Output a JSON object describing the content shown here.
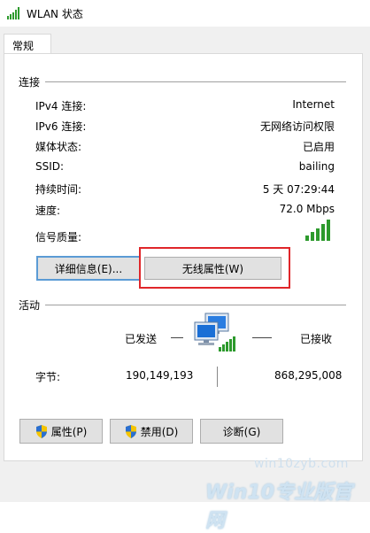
{
  "window": {
    "title": "WLAN 状态"
  },
  "tabs": [
    {
      "label": "常规"
    }
  ],
  "connection": {
    "group_label": "连接",
    "rows": [
      {
        "label": "IPv4 连接:",
        "value": "Internet"
      },
      {
        "label": "IPv6 连接:",
        "value": "无网络访问权限"
      },
      {
        "label": "媒体状态:",
        "value": "已启用"
      },
      {
        "label": "SSID:",
        "value": "bailing"
      },
      {
        "label": "持续时间:",
        "value": "5 天 07:29:44"
      },
      {
        "label": "速度:",
        "value": "72.0 Mbps"
      }
    ],
    "signal": {
      "label": "信号质量:",
      "bars_filled": 5,
      "bars_total": 5
    }
  },
  "buttons": {
    "details": "详细信息(E)...",
    "wireless_properties": "无线属性(W)",
    "properties": "属性(P)",
    "disable": "禁用(D)",
    "diagnose": "诊断(G)"
  },
  "activity": {
    "group_label": "活动",
    "sent_label": "已发送",
    "received_label": "已接收",
    "bytes_label": "字节:",
    "bytes_sent": "190,149,193",
    "bytes_received": "868,295,008"
  },
  "watermark": {
    "line1": "win10zyb.com",
    "line2": "Win10专业版官网"
  },
  "colors": {
    "highlight_border": "#e0262a",
    "signal_green": "#2d9a2d",
    "focus_border": "#5b9bd5"
  },
  "icons": [
    "wifi-signal-icon",
    "network-computers-icon",
    "uac-shield-icon"
  ]
}
